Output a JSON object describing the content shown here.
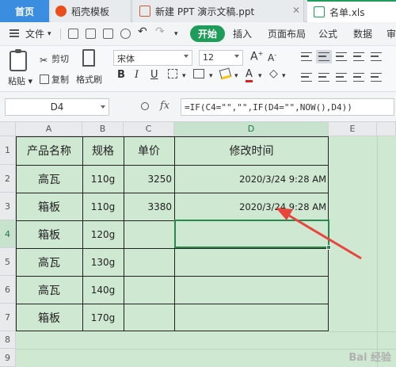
{
  "tabs": {
    "home": "首页",
    "template": "稻壳模板",
    "ppt": "新建 PPT 演示文稿.ppt",
    "xls": "名单.xls",
    "close_icon": "close-icon"
  },
  "menu": {
    "file": "文件",
    "start": "开始",
    "insert": "插入",
    "layout": "页面布局",
    "formula": "公式",
    "data": "数据",
    "review": "审"
  },
  "ribbon": {
    "paste": "粘贴",
    "cut": "剪切",
    "copy": "复制",
    "format_painter": "格式刷",
    "font_name": "宋体",
    "font_size": "12",
    "bold": "B",
    "italic": "I",
    "underline": "U",
    "font_color_letter": "A",
    "grow_font": "A",
    "shrink_font": "A",
    "accent_color": "#1e9c5a",
    "font_color": "#e02020"
  },
  "formula_bar": {
    "cell_ref": "D4",
    "fx": "fx",
    "formula": "=IF(C4=\"\",\"\",IF(D4=\"\",NOW(),D4))"
  },
  "grid": {
    "columns": [
      "A",
      "B",
      "C",
      "D",
      "E"
    ],
    "rows": [
      "1",
      "2",
      "3",
      "4",
      "5",
      "6",
      "7",
      "8",
      "9"
    ],
    "header": {
      "name": "产品名称",
      "spec": "规格",
      "price": "单价",
      "mod_time": "修改时间"
    },
    "data": [
      {
        "name": "高瓦",
        "spec": "110g",
        "price": "3250",
        "time": "2020/3/24  9:28 AM"
      },
      {
        "name": "箱板",
        "spec": "110g",
        "price": "3380",
        "time": "2020/3/24  9:28 AM"
      },
      {
        "name": "箱板",
        "spec": "120g",
        "price": "",
        "time": ""
      },
      {
        "name": "高瓦",
        "spec": "130g",
        "price": "",
        "time": ""
      },
      {
        "name": "高瓦",
        "spec": "140g",
        "price": "",
        "time": ""
      },
      {
        "name": "箱板",
        "spec": "170g",
        "price": "",
        "time": ""
      }
    ],
    "active_cell": "D4",
    "sheet_bg": "#cfe8d2",
    "arrow_color": "#e8453c"
  },
  "watermark": "Bai 经验"
}
